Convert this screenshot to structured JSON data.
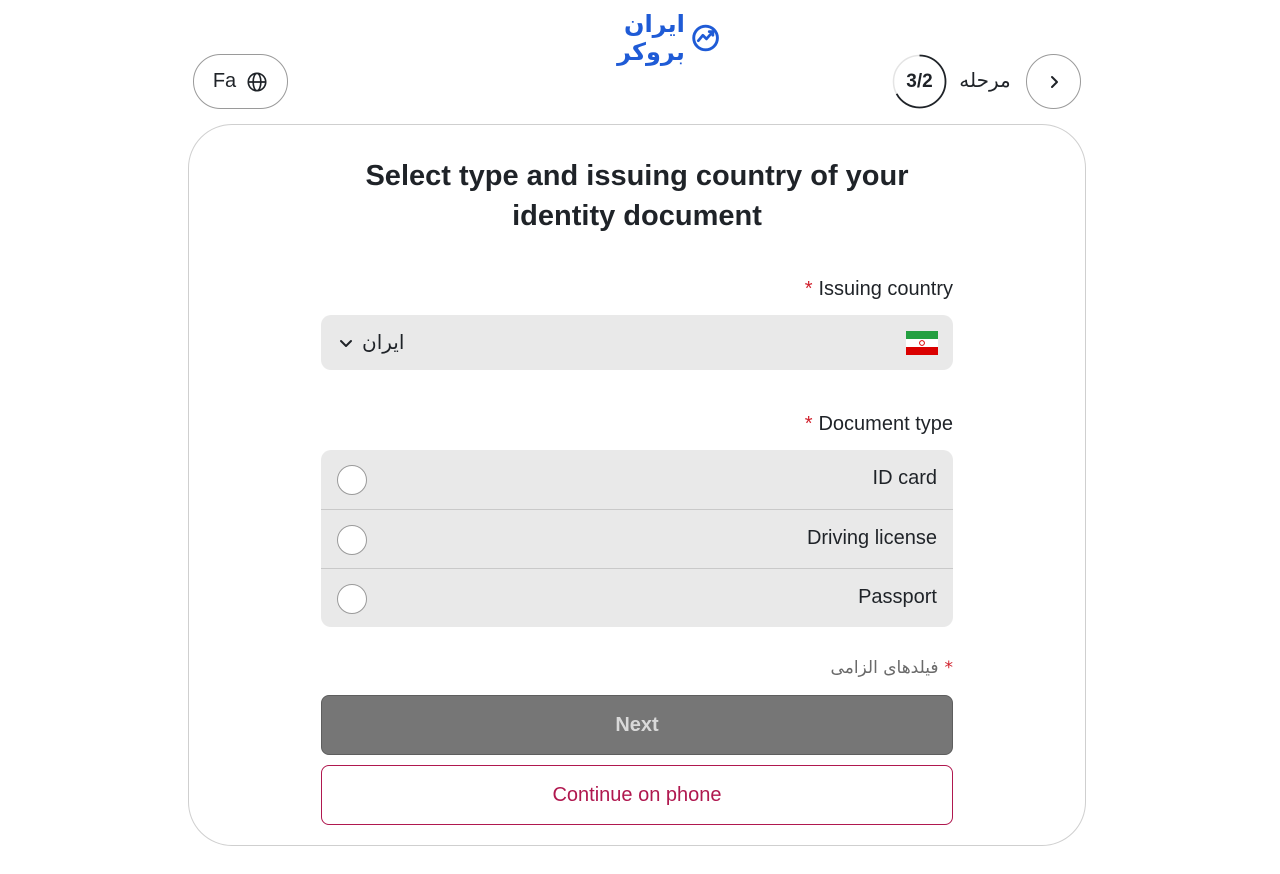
{
  "brand": {
    "logo_text": "ایران بروکر",
    "logo_color": "#1f5bd6"
  },
  "header": {
    "language_label": "Fa",
    "step_label": "مرحله",
    "step_count": "3/2",
    "step_progress_fraction": 0.67
  },
  "form": {
    "title": "Select type and issuing country of your identity document",
    "issuing_country": {
      "label": "Issuing country",
      "required_mark": "*",
      "selected_value": "ایران",
      "flag": "iran-flag-icon"
    },
    "document_type": {
      "label": "Document type",
      "required_mark": "*",
      "options": [
        {
          "label": "ID card",
          "selected": false
        },
        {
          "label": "Driving license",
          "selected": false
        },
        {
          "label": "Passport",
          "selected": false
        }
      ]
    },
    "required_note_mark": "*",
    "required_note": "فیلدهای الزامی",
    "next_label": "Next",
    "continue_phone_label": "Continue on phone"
  },
  "colors": {
    "accent": "#b0184f",
    "required": "#d0202c",
    "disabled_button": "#767676",
    "field_bg": "#e9e9e9"
  }
}
